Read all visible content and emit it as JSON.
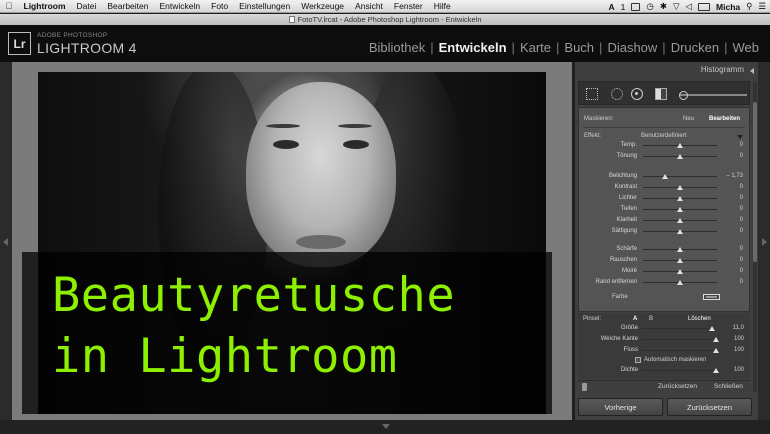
{
  "menubar": {
    "items": [
      "Lightroom",
      "Datei",
      "Bearbeiten",
      "Entwickeln",
      "Foto",
      "Einstellungen",
      "Werkzeuge",
      "Ansicht",
      "Fenster",
      "Hilfe"
    ],
    "status_1": "1",
    "user": "Micha"
  },
  "window": {
    "title": "FotoTV.lrcat - Adobe Photoshop Lightroom - Entwickeln"
  },
  "brand": {
    "sub": "ADOBE PHOTOSHOP",
    "main": "LIGHTROOM 4",
    "logo": "Lr"
  },
  "modules": [
    {
      "label": "Bibliothek",
      "active": false
    },
    {
      "label": "Entwickeln",
      "active": true
    },
    {
      "label": "Karte",
      "active": false
    },
    {
      "label": "Buch",
      "active": false
    },
    {
      "label": "Diashow",
      "active": false
    },
    {
      "label": "Drucken",
      "active": false
    },
    {
      "label": "Web",
      "active": false
    }
  ],
  "overlay": {
    "line1": "Beautyretusche",
    "line2": "in Lightroom",
    "color": "#8cf000"
  },
  "panel": {
    "histogram_label": "Histogramm",
    "mask_label": "Maskieren:",
    "mask_new": "Neu",
    "mask_edit": "Bearbeiten",
    "effect_label": "Effekt:",
    "effect_value": "Benutzerdefiniert",
    "sliders_a": [
      {
        "label": "Temp.",
        "value": "0",
        "pos": 0.5
      },
      {
        "label": "Tönung",
        "value": "0",
        "pos": 0.5
      }
    ],
    "sliders_b": [
      {
        "label": "Belichtung",
        "value": "– 1,73",
        "pos": 0.3
      },
      {
        "label": "Kontrast",
        "value": "0",
        "pos": 0.5
      },
      {
        "label": "Lichter",
        "value": "0",
        "pos": 0.5
      },
      {
        "label": "Tiefen",
        "value": "0",
        "pos": 0.5
      },
      {
        "label": "Klarheit",
        "value": "0",
        "pos": 0.5
      },
      {
        "label": "Sättigung",
        "value": "0",
        "pos": 0.5
      }
    ],
    "sliders_c": [
      {
        "label": "Schärfe",
        "value": "0",
        "pos": 0.5
      },
      {
        "label": "Rauschen",
        "value": "0",
        "pos": 0.5
      },
      {
        "label": "Moiré",
        "value": "0",
        "pos": 0.5
      },
      {
        "label": "Rand entfernen",
        "value": "0",
        "pos": 0.5
      }
    ],
    "color_label": "Farbe",
    "brush_label": "Pinsel:",
    "brush_a": "A",
    "brush_b": "B",
    "brush_erase": "Löschen",
    "brush_sliders": [
      {
        "label": "Größe",
        "value": "11,0",
        "pos": 0.95
      },
      {
        "label": "Weiche Kante",
        "value": "100",
        "pos": 1.0
      },
      {
        "label": "Fluss",
        "value": "100",
        "pos": 1.0
      }
    ],
    "auto_mask": "Automatisch maskieren",
    "density": {
      "label": "Dichte",
      "value": "100",
      "pos": 1.0
    },
    "reset_small": "Zurücksetzen",
    "close_small": "Schließen",
    "btn_previous": "Vorherige",
    "btn_reset": "Zurücksetzen"
  }
}
